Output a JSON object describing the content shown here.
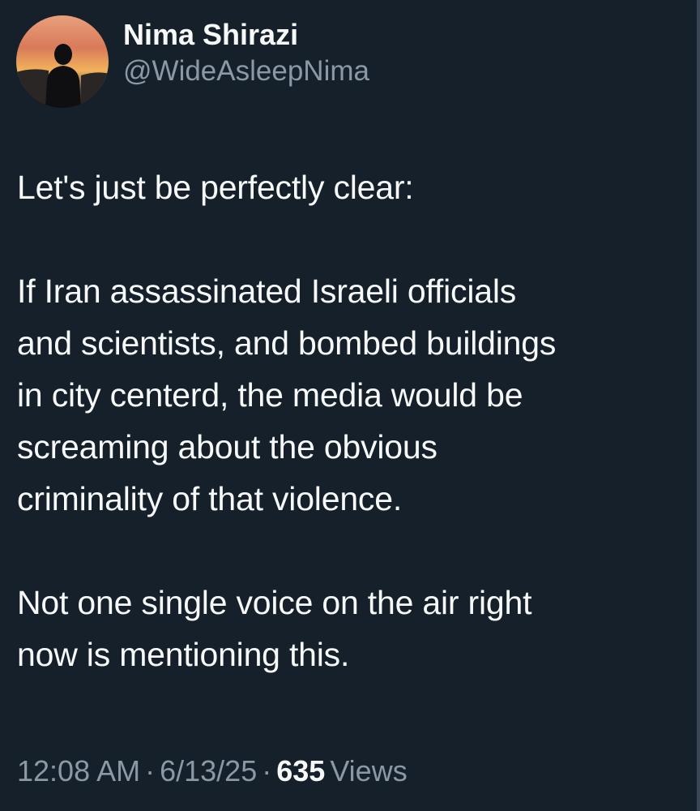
{
  "author": {
    "display_name": "Nima Shirazi",
    "handle": "@WideAsleepNima",
    "avatar_icon": "avatar-silhouette-sunset"
  },
  "tweet": {
    "text": "Let's just be perfectly clear:\n\nIf Iran assassinated Israeli officials\nand scientists, and bombed buildings\nin city centerd, the media would be\nscreaming about the obvious\ncriminality of that violence.\n\nNot one single voice on the air right\nnow is mentioning this."
  },
  "meta": {
    "time": "12:08 AM",
    "separator": "·",
    "date": "6/13/25",
    "views_count": "635",
    "views_label": "Views"
  },
  "colors": {
    "background": "#15202b",
    "primary_text": "#f7f9f9",
    "secondary_text": "#8b98a5"
  }
}
